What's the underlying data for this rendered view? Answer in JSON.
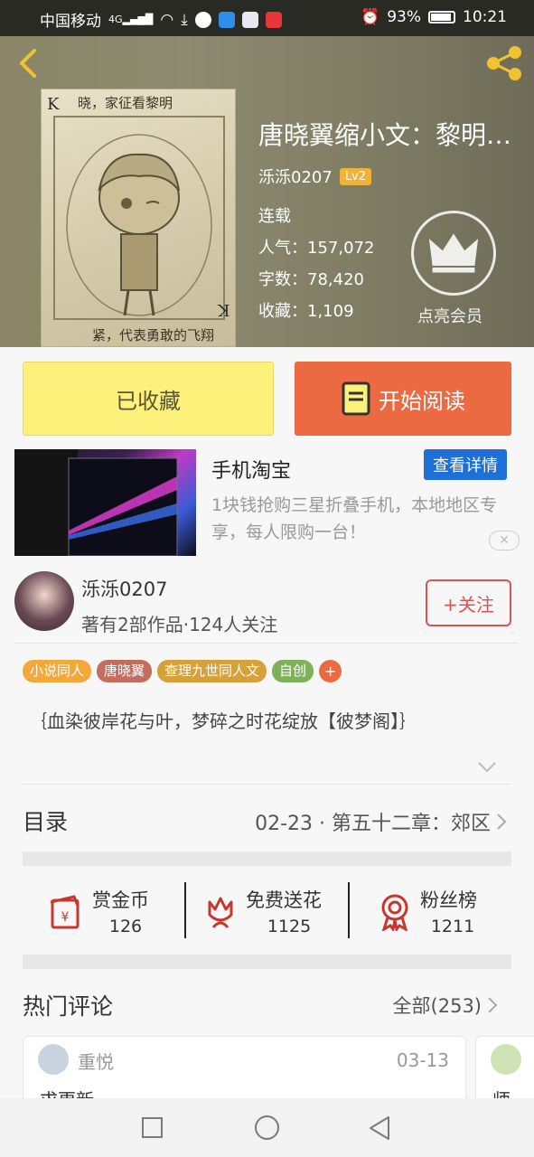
{
  "status_bar": {
    "carrier": "中国移动",
    "signal_label": "4G",
    "battery": "93%",
    "time": "10:21"
  },
  "book": {
    "title": "唐晓翼缩小文：黎明…",
    "author": "泺泺0207",
    "level": "Lv2",
    "status": "连载",
    "popularity_label": "人气：",
    "popularity": "157,072",
    "words_label": "字数：",
    "words": "78,420",
    "favorites_label": "收藏：",
    "favorites": "1,109",
    "cover_top_text": "晓，家征看黎明",
    "cover_bottom_text": "紧，代表勇敢的飞翔",
    "cover_card_letter": "K"
  },
  "vip": {
    "label": "点亮会员"
  },
  "actions": {
    "favorited_label": "已收藏",
    "read_label": "开始阅读"
  },
  "ad": {
    "title": "手机淘宝",
    "button": "查看详情",
    "description": "1块钱抢购三星折叠手机，本地地区专享，每人限购一台！",
    "close": "✕"
  },
  "author_card": {
    "name": "泺泺0207",
    "meta": "著有2部作品·124人关注",
    "follow": "+关注"
  },
  "tags": [
    {
      "label": "小说同人",
      "color": "#f2a93a"
    },
    {
      "label": "唐晓翼",
      "color": "#c46d5e"
    },
    {
      "label": "查理九世同人文",
      "color": "#d6a03a"
    },
    {
      "label": "自创",
      "color": "#7fb05a"
    }
  ],
  "tag_more": "+",
  "description": "｛血染彼岸花与叶，梦碎之时花绽放【彼梦阁】｝",
  "toc": {
    "label": "目录",
    "latest": "02-23 · 第五十二章：郊区"
  },
  "stats": [
    {
      "label": "赏金币",
      "value": "126",
      "icon": "red-envelope-icon"
    },
    {
      "label": "免费送花",
      "value": "1125",
      "icon": "flower-icon"
    },
    {
      "label": "粉丝榜",
      "value": "1211",
      "icon": "medal-icon"
    }
  ],
  "comments": {
    "label": "热门评论",
    "all": "全部(253)",
    "items": [
      {
        "user": "重悦",
        "date": "03-13",
        "text": "求更新"
      },
      {
        "user": "",
        "date": "",
        "text": "师"
      }
    ]
  },
  "colors": {
    "accent_orange": "#ec6a42",
    "fav_yellow": "#fdf17c",
    "follow_red": "#e35050",
    "ad_blue": "#1e6fd6"
  }
}
